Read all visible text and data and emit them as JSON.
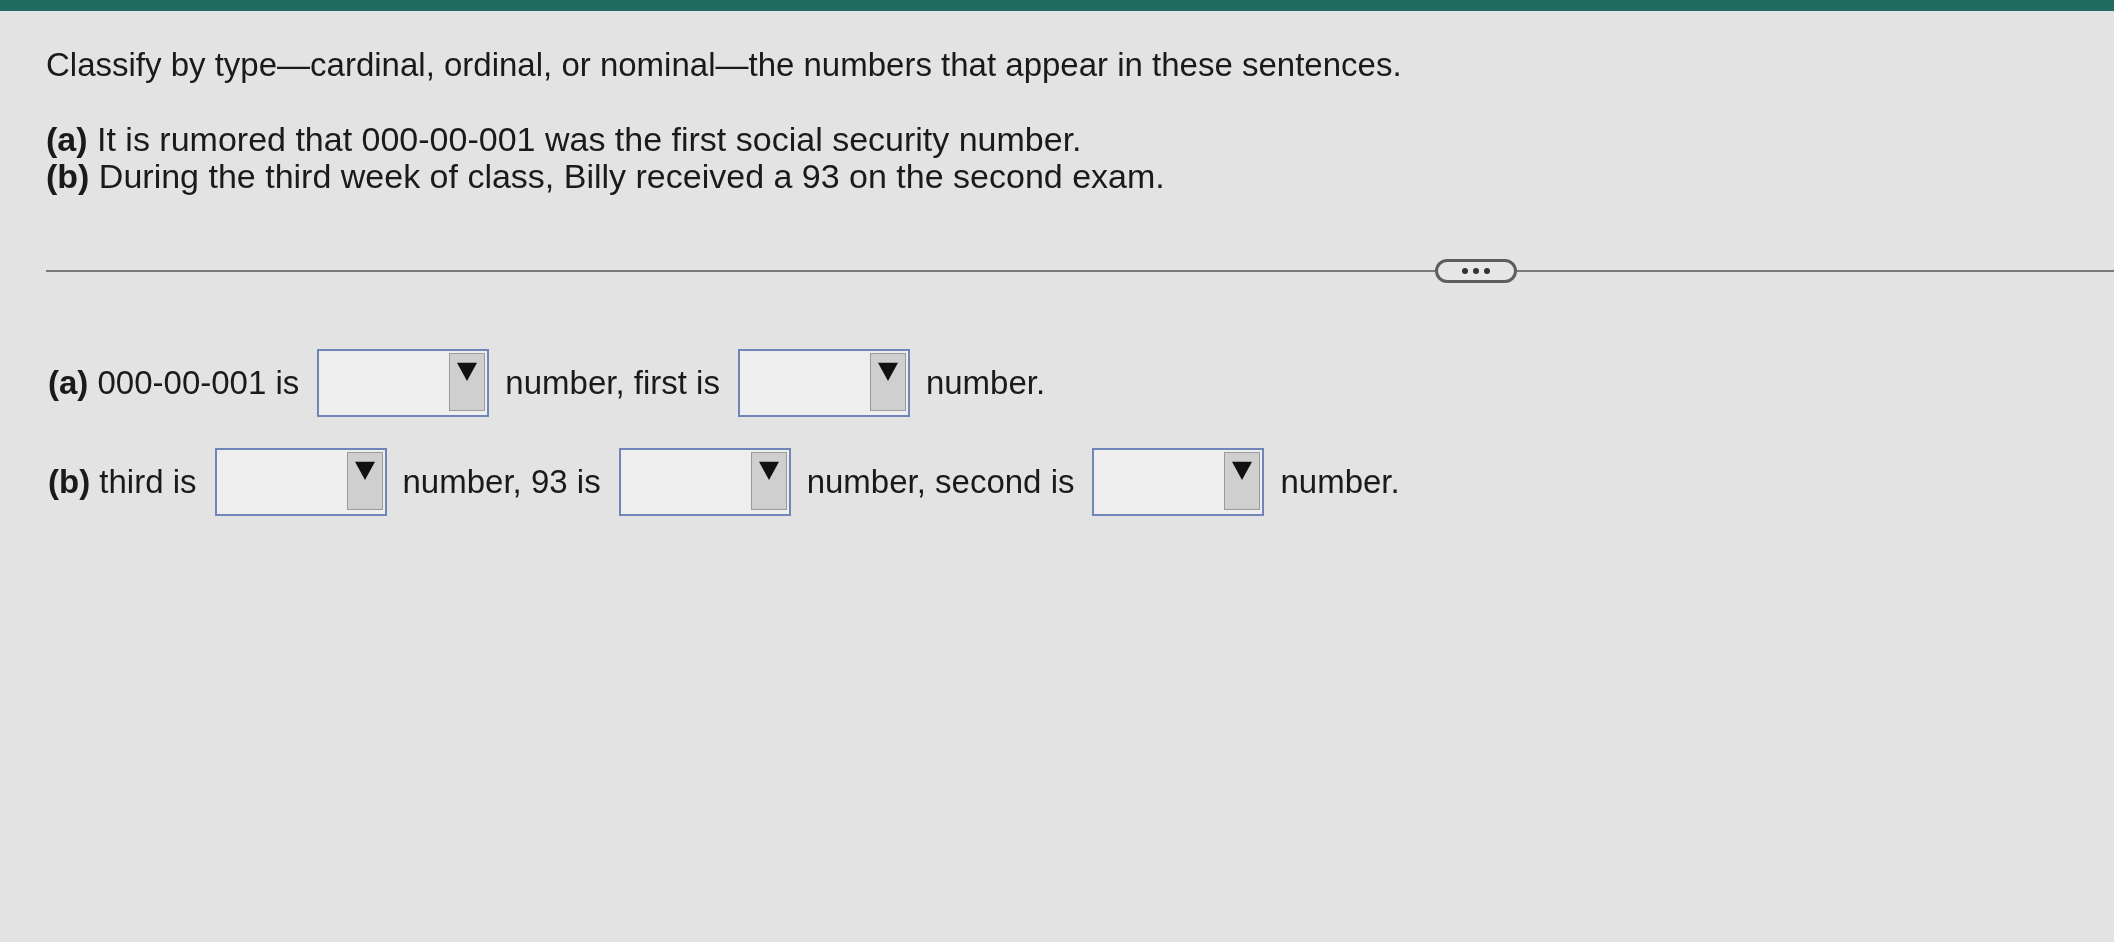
{
  "question": {
    "prompt": "Classify by type—cardinal, ordinal, or nominal—the numbers that appear in these sentences.",
    "sentences": [
      "**(a)** It is rumored that 000-00-001 was the first social security number.",
      "**(b)** During the third week of class, Billy received a 93 on the second exam."
    ]
  },
  "answers": [
    {
      "parts": [
        {
          "kind": "text",
          "text": "**(a)** 000-00-001 is"
        },
        {
          "kind": "dropdown"
        },
        {
          "kind": "text",
          "text": "number, first is"
        },
        {
          "kind": "dropdown"
        },
        {
          "kind": "text",
          "text": "number."
        }
      ]
    },
    {
      "parts": [
        {
          "kind": "text",
          "text": "**(b)** third is"
        },
        {
          "kind": "dropdown"
        },
        {
          "kind": "text",
          "text": "number, 93 is"
        },
        {
          "kind": "dropdown"
        },
        {
          "kind": "text",
          "text": "number, second is"
        },
        {
          "kind": "dropdown"
        },
        {
          "kind": "text",
          "text": "number."
        }
      ]
    }
  ]
}
